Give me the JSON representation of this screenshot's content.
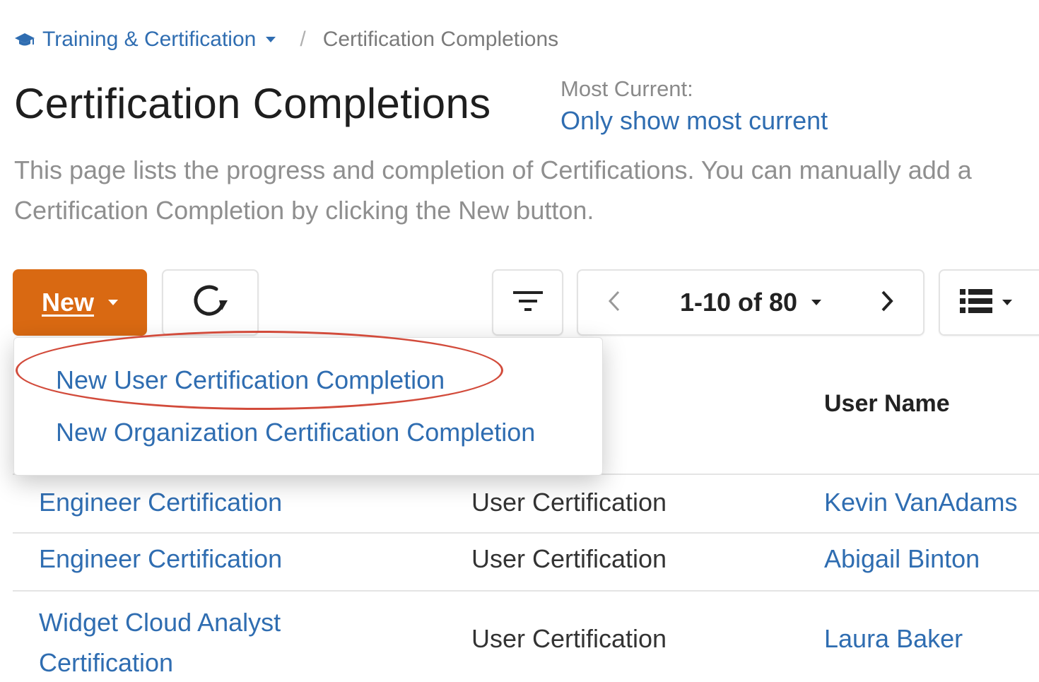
{
  "breadcrumb": {
    "icon": "graduation-cap-icon",
    "parent": "Training & Certification",
    "separator": "/",
    "current": "Certification Completions"
  },
  "page": {
    "title": "Certification Completions",
    "most_current_label": "Most Current:",
    "most_current_link": "Only show most current",
    "description": "This page lists the progress and completion of Certifications. You can manually add a Certification Completion by clicking the New button."
  },
  "toolbar": {
    "new_label": "New",
    "refresh_icon": "refresh-icon",
    "filter_icon": "filter-icon",
    "pager_text": "1-10 of 80",
    "view_icon": "list-view-icon"
  },
  "dropdown": {
    "items": [
      "New User Certification Completion",
      "New Organization Certification Completion"
    ]
  },
  "table": {
    "headers": {
      "user_name": "User Name"
    },
    "rows": [
      {
        "certification": "Engineer Certification",
        "type": "User Certification",
        "user": "Kevin VanAdams"
      },
      {
        "certification": "Engineer Certification",
        "type": "User Certification",
        "user": "Abigail Binton"
      },
      {
        "certification": "Widget Cloud Analyst Certification",
        "type": "User Certification",
        "user": "Laura Baker"
      }
    ]
  },
  "colors": {
    "accent": "#d96912",
    "link": "#2f6db1",
    "annotation": "#d24b3b"
  }
}
